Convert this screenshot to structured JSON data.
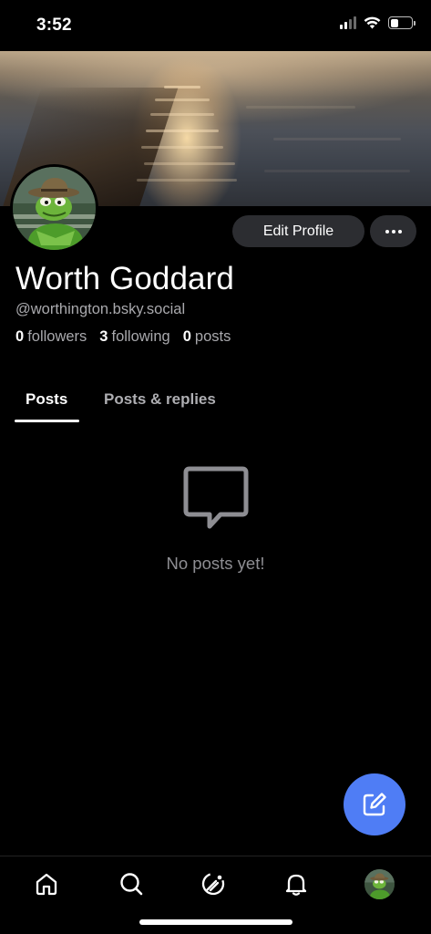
{
  "status_bar": {
    "time": "3:52",
    "signal_icon": "cellular-signal-icon",
    "wifi_icon": "wifi-icon",
    "battery_icon": "battery-icon",
    "battery_level": 0.4
  },
  "profile": {
    "display_name": "Worth Goddard",
    "handle": "@worthington.bsky.social",
    "followers_count": "0",
    "followers_label": "followers",
    "following_count": "3",
    "following_label": "following",
    "posts_count": "0",
    "posts_label": "posts",
    "edit_profile_label": "Edit Profile",
    "more_icon": "more-horizontal-icon"
  },
  "tabs": [
    {
      "label": "Posts",
      "selected": true
    },
    {
      "label": "Posts & replies",
      "selected": false
    }
  ],
  "empty_state": {
    "icon": "message-bubble-icon",
    "text": "No posts yet!"
  },
  "fab": {
    "icon": "compose-icon"
  },
  "bottom_nav": [
    {
      "icon": "home-icon"
    },
    {
      "icon": "search-icon"
    },
    {
      "icon": "feeds-icon"
    },
    {
      "icon": "notifications-icon"
    },
    {
      "icon": "profile-avatar-icon"
    }
  ],
  "colors": {
    "background": "#000000",
    "accent": "#4f7df5",
    "button_bg": "#2c2d31",
    "secondary_text": "#a9a9ad",
    "muted_text": "#8e8e93"
  }
}
